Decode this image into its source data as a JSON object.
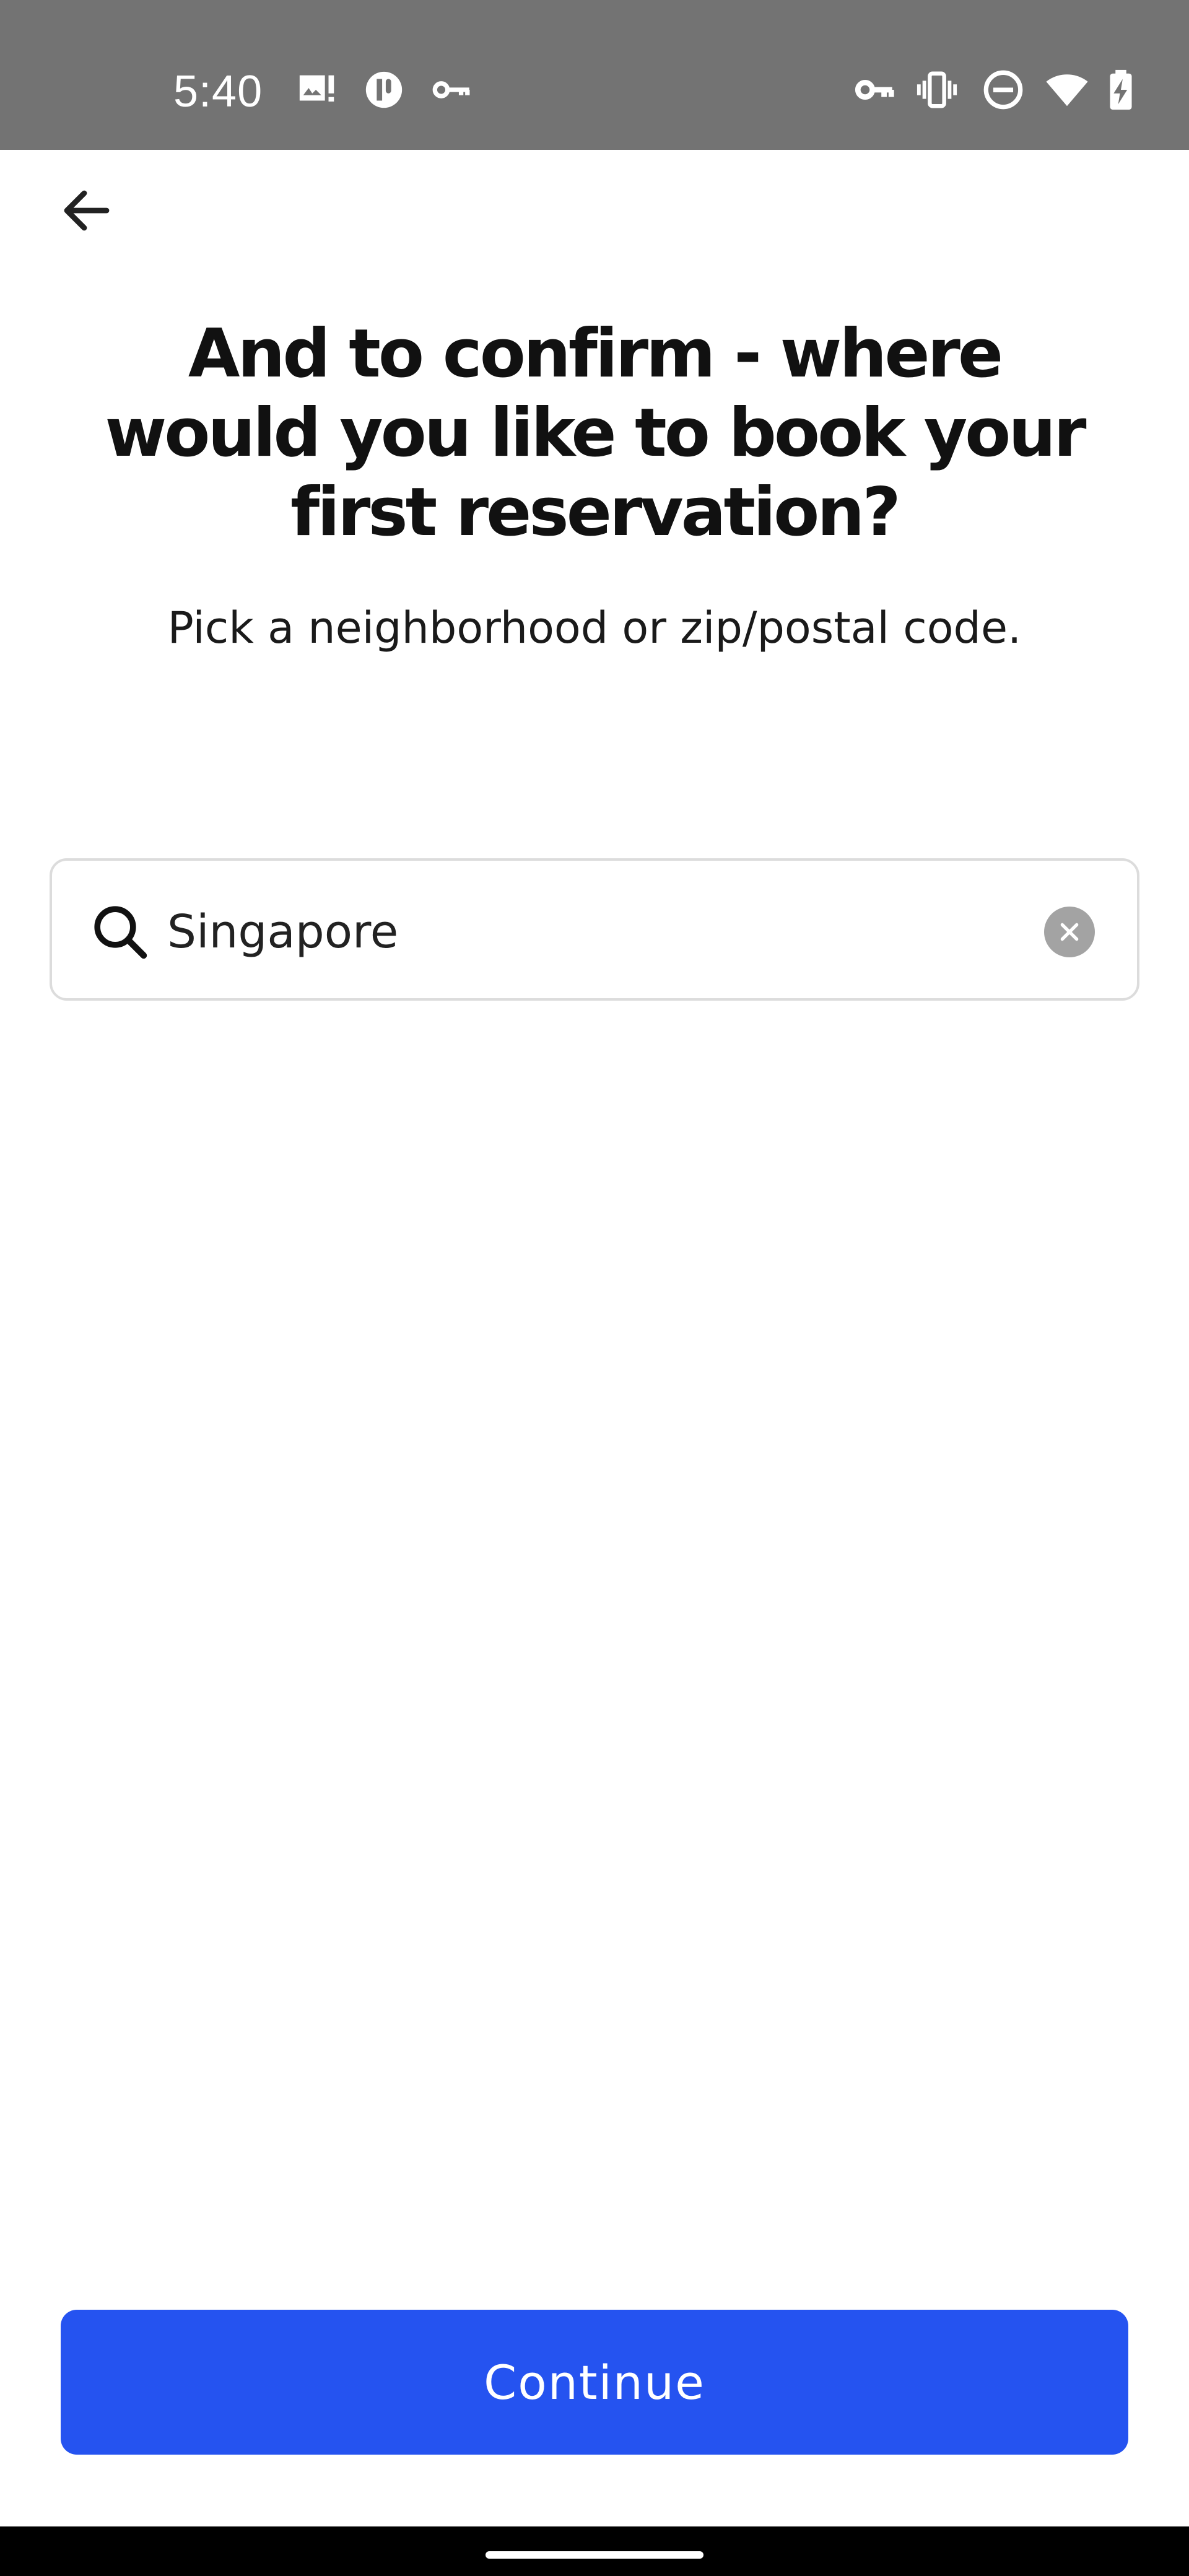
{
  "status_bar": {
    "time": "5:40",
    "left_icons": [
      "image-alert-icon",
      "app-badge-icon",
      "key-icon"
    ],
    "right_icons": [
      "vpn-key-icon",
      "vibrate-icon",
      "do-not-disturb-icon",
      "wifi-icon",
      "battery-charging-icon"
    ]
  },
  "header": {
    "back_icon": "arrow-left-icon"
  },
  "main": {
    "title": "And to confirm - where would you like to book your first reservation?",
    "subtitle": "Pick a neighborhood or zip/postal code."
  },
  "search": {
    "value": "Singapore",
    "icon": "search-icon",
    "clear_icon": "clear-icon"
  },
  "footer": {
    "continue_label": "Continue",
    "continue_color": "#2553f0"
  },
  "colors": {
    "status_bar": "#737373",
    "accent": "#2553f0",
    "field_border": "#dcdcdc",
    "clear_icon_bg": "#a3a3a3"
  }
}
